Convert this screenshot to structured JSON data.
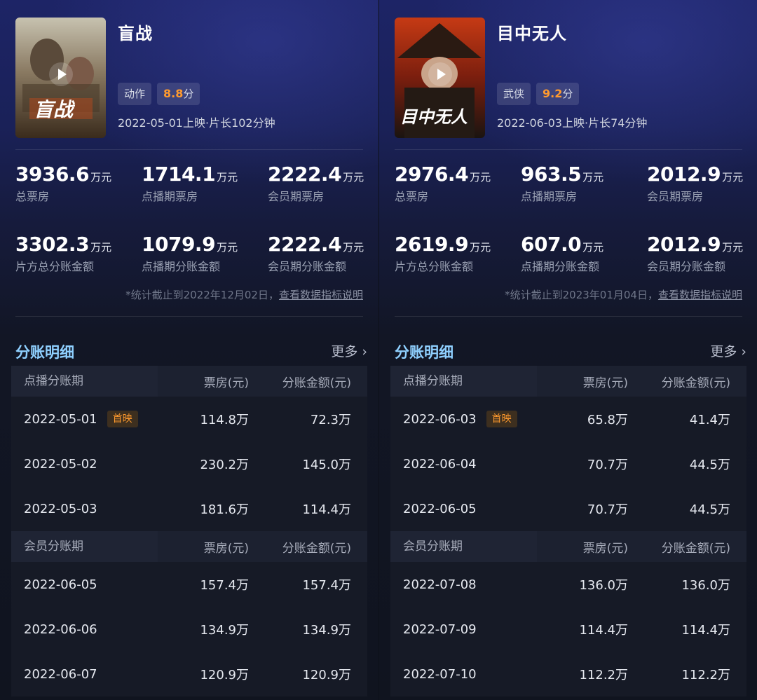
{
  "colors": {
    "accent_score": "#ff9a2e",
    "section_title": "#8fd0ff",
    "background": "#101522"
  },
  "movies": [
    {
      "title": "盲战",
      "genre": "动作",
      "score": "8.8",
      "score_unit": "分",
      "release": "2022-05-01上映·片长102分钟",
      "poster_text": "盲战",
      "stats_row1": [
        {
          "value": "3936.6",
          "unit": "万元",
          "label": "总票房"
        },
        {
          "value": "1714.1",
          "unit": "万元",
          "label": "点播期票房"
        },
        {
          "value": "2222.4",
          "unit": "万元",
          "label": "会员期票房"
        }
      ],
      "stats_row2": [
        {
          "value": "3302.3",
          "unit": "万元",
          "label": "片方总分账金额"
        },
        {
          "value": "1079.9",
          "unit": "万元",
          "label": "点播期分账金额"
        },
        {
          "value": "2222.4",
          "unit": "万元",
          "label": "会员期分账金额"
        }
      ],
      "note_prefix": "*统计截止到2022年12月02日，",
      "note_link": "查看数据指标说明",
      "section_title": "分账明细",
      "more": "更多 ›",
      "vod_header": [
        "点播分账期",
        "票房(元)",
        "分账金额(元)"
      ],
      "vod_rows": [
        {
          "date": "2022-05-01",
          "badge": "首映",
          "box": "114.8万",
          "share": "72.3万"
        },
        {
          "date": "2022-05-02",
          "badge": "",
          "box": "230.2万",
          "share": "145.0万"
        },
        {
          "date": "2022-05-03",
          "badge": "",
          "box": "181.6万",
          "share": "114.4万"
        }
      ],
      "member_header": [
        "会员分账期",
        "票房(元)",
        "分账金额(元)"
      ],
      "member_rows": [
        {
          "date": "2022-06-05",
          "badge": "",
          "box": "157.4万",
          "share": "157.4万"
        },
        {
          "date": "2022-06-06",
          "badge": "",
          "box": "134.9万",
          "share": "134.9万"
        },
        {
          "date": "2022-06-07",
          "badge": "",
          "box": "120.9万",
          "share": "120.9万"
        }
      ]
    },
    {
      "title": "目中无人",
      "genre": "武侠",
      "score": "9.2",
      "score_unit": "分",
      "release": "2022-06-03上映·片长74分钟",
      "poster_text": "目中无人",
      "stats_row1": [
        {
          "value": "2976.4",
          "unit": "万元",
          "label": "总票房"
        },
        {
          "value": "963.5",
          "unit": "万元",
          "label": "点播期票房"
        },
        {
          "value": "2012.9",
          "unit": "万元",
          "label": "会员期票房"
        }
      ],
      "stats_row2": [
        {
          "value": "2619.9",
          "unit": "万元",
          "label": "片方总分账金额"
        },
        {
          "value": "607.0",
          "unit": "万元",
          "label": "点播期分账金额"
        },
        {
          "value": "2012.9",
          "unit": "万元",
          "label": "会员期分账金额"
        }
      ],
      "note_prefix": "*统计截止到2023年01月04日，",
      "note_link": "查看数据指标说明",
      "section_title": "分账明细",
      "more": "更多 ›",
      "vod_header": [
        "点播分账期",
        "票房(元)",
        "分账金额(元)"
      ],
      "vod_rows": [
        {
          "date": "2022-06-03",
          "badge": "首映",
          "box": "65.8万",
          "share": "41.4万"
        },
        {
          "date": "2022-06-04",
          "badge": "",
          "box": "70.7万",
          "share": "44.5万"
        },
        {
          "date": "2022-06-05",
          "badge": "",
          "box": "70.7万",
          "share": "44.5万"
        }
      ],
      "member_header": [
        "会员分账期",
        "票房(元)",
        "分账金额(元)"
      ],
      "member_rows": [
        {
          "date": "2022-07-08",
          "badge": "",
          "box": "136.0万",
          "share": "136.0万"
        },
        {
          "date": "2022-07-09",
          "badge": "",
          "box": "114.4万",
          "share": "114.4万"
        },
        {
          "date": "2022-07-10",
          "badge": "",
          "box": "112.2万",
          "share": "112.2万"
        }
      ]
    }
  ]
}
